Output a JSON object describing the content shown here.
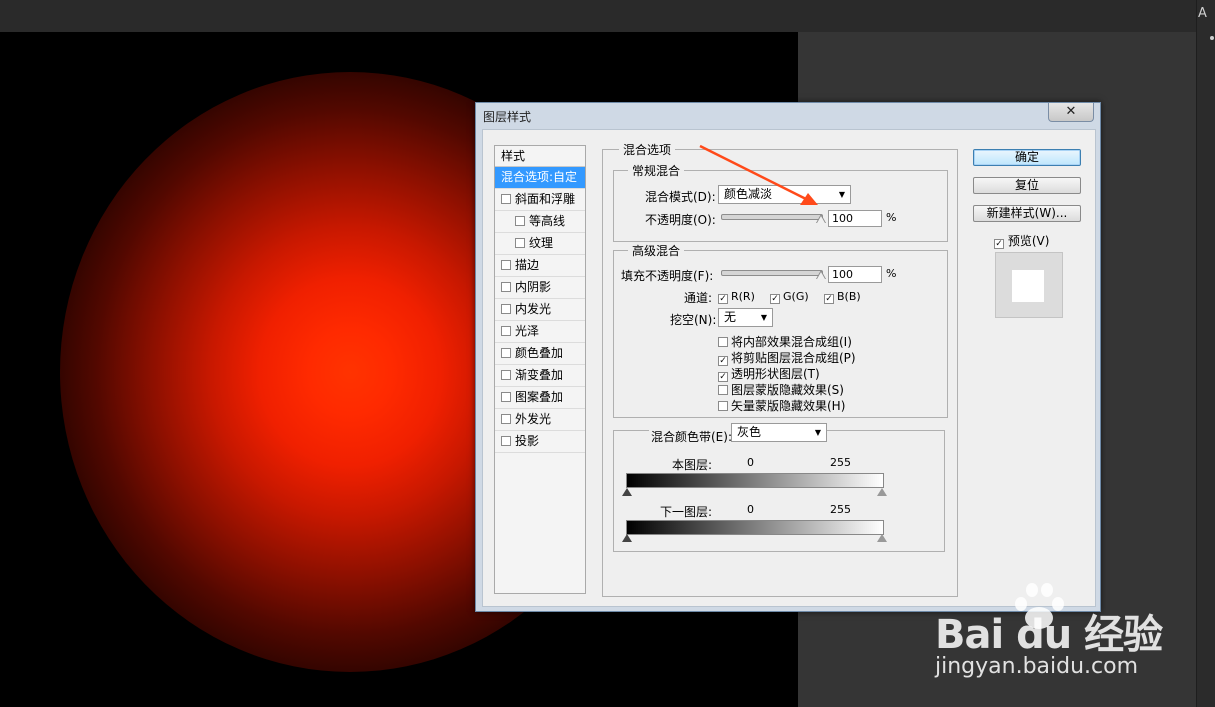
{
  "dialog": {
    "title": "图层样式",
    "close_label": "✕"
  },
  "styles": {
    "header": "样式",
    "items": [
      {
        "label": "混合选项:自定",
        "selected": true,
        "has_checkbox": false,
        "indent": 0
      },
      {
        "label": "斜面和浮雕",
        "checked": false,
        "has_checkbox": true,
        "indent": 0
      },
      {
        "label": "等高线",
        "checked": false,
        "has_checkbox": true,
        "indent": 1
      },
      {
        "label": "纹理",
        "checked": false,
        "has_checkbox": true,
        "indent": 1
      },
      {
        "label": "描边",
        "checked": false,
        "has_checkbox": true,
        "indent": 0
      },
      {
        "label": "内阴影",
        "checked": false,
        "has_checkbox": true,
        "indent": 0
      },
      {
        "label": "内发光",
        "checked": false,
        "has_checkbox": true,
        "indent": 0
      },
      {
        "label": "光泽",
        "checked": false,
        "has_checkbox": true,
        "indent": 0
      },
      {
        "label": "颜色叠加",
        "checked": false,
        "has_checkbox": true,
        "indent": 0
      },
      {
        "label": "渐变叠加",
        "checked": false,
        "has_checkbox": true,
        "indent": 0
      },
      {
        "label": "图案叠加",
        "checked": false,
        "has_checkbox": true,
        "indent": 0
      },
      {
        "label": "外发光",
        "checked": false,
        "has_checkbox": true,
        "indent": 0
      },
      {
        "label": "投影",
        "checked": false,
        "has_checkbox": true,
        "indent": 0
      }
    ]
  },
  "blend": {
    "section_title": "混合选项",
    "general": {
      "title": "常规混合",
      "mode_label": "混合模式(D):",
      "mode_value": "颜色减淡",
      "opacity_label": "不透明度(O):",
      "opacity_value": "100",
      "opacity_fraction": 1.0,
      "percent": "%"
    },
    "advanced": {
      "title": "高级混合",
      "fill_label": "填充不透明度(F):",
      "fill_value": "100",
      "fill_fraction": 1.0,
      "percent": "%",
      "channels_label": "通道:",
      "channels": [
        {
          "label": "R(R)",
          "checked": true
        },
        {
          "label": "G(G)",
          "checked": true
        },
        {
          "label": "B(B)",
          "checked": true
        }
      ],
      "knockout_label": "挖空(N):",
      "knockout_value": "无",
      "options": [
        {
          "label": "将内部效果混合成组(I)",
          "checked": false
        },
        {
          "label": "将剪贴图层混合成组(P)",
          "checked": true
        },
        {
          "label": "透明形状图层(T)",
          "checked": true
        },
        {
          "label": "图层蒙版隐藏效果(S)",
          "checked": false
        },
        {
          "label": "矢量蒙版隐藏效果(H)",
          "checked": false
        }
      ]
    },
    "blend_if": {
      "label": "混合颜色带(E):",
      "value": "灰色",
      "this_layer_label": "本图层:",
      "this_layer_min": "0",
      "this_layer_max": "255",
      "underlying_label": "下一图层:",
      "underlying_min": "0",
      "underlying_max": "255"
    }
  },
  "buttons": {
    "ok": "确定",
    "reset": "复位",
    "new_style": "新建样式(W)...",
    "preview_label": "预览(V)",
    "preview_checked": true
  },
  "check_mark": "✓",
  "caret": "▼",
  "watermark": {
    "logo": "Bai du 经验",
    "url": "jingyan.baidu.com"
  },
  "colors": {
    "glow_core": "#ff3300",
    "selection": "#3399ff",
    "arrow": "#ff4a1a"
  },
  "icons": {
    "close": "close-icon",
    "dropdown": "chevron-down-icon",
    "paw": "baidu-paw-icon"
  }
}
